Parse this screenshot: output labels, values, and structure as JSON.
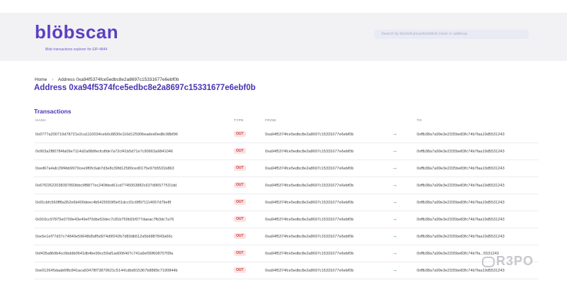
{
  "header": {
    "logo": "blöbscan",
    "tagline": "Blob transactions explorer for EIP-4844",
    "search_placeholder": "Search by block/transaction/blob Hash or address"
  },
  "breadcrumb": {
    "home": "Home",
    "separator": "›",
    "current": "Address 0xa94f5374fce5edbc8e2a8697c15331677e6ebf0b"
  },
  "page_title": "Address 0xa94f5374fce5edbc8e2a8697c15331677e6ebf0b",
  "transactions": {
    "title": "Transactions",
    "columns": [
      "HASH",
      "TYPE",
      "FROM",
      "TO"
    ],
    "rows": [
      {
        "hash": "0x0777a200710d78721e2ca1110034ceb0c8830e116d125906eaded0ed8c98bf96",
        "type": "OUT",
        "from": "0xa94f5374fce5edbc8e2a8697c15331677e6ebf0b",
        "to": "0xffb38a7a99e3e2335be83fc74b7faa19d5531243"
      },
      {
        "hash": "0x903a2f80784fa09e7114d2a08dfecfcdfde7a72cf41b5d71e7c90663a9841046",
        "type": "OUT",
        "from": "0xa94f5374fce5edbc8e2a8697c15331677e6ebf0b",
        "to": "0xffb38a7a99e3e2335be83fc74b7faa19d5531243"
      },
      {
        "hash": "0xed67a4afc29f4bb9970cee9f0fc6ab7d3e8c39fd12580ced0175e97b5531b863",
        "type": "OUT",
        "from": "0xa94f5374fce5edbc8e2a8697c15331677e6ebf0b",
        "to": "0xffb38a7a99e3e2335be83fc74b7faa19d5531243"
      },
      {
        "hash": "0x67f22622038397893bbc9f8877ec240fded61cd7745053882c637d96577531dd",
        "type": "OUT",
        "from": "0xa94f5374fce5edbc8e2a8697c15331677e6ebf0b",
        "to": "0xffb38a7a99e3e2335be83fc74b7faa19d5531243"
      },
      {
        "hash": "0x91cbfc560ff8a352e6b400deec4b5426559f0e51dcc01c6ff971114657d79e8f",
        "type": "OUT",
        "from": "0xa94f5374fce5edbc8e2a8697c15331677e6ebf0b",
        "to": "0xffb38a7a99e3e2335be83fc74b7faa19d5531243"
      },
      {
        "hash": "0x916cc97875e0709e43e49ef70dbe52dec7c81b759b91f077daeac7fb3dc7a76",
        "type": "OUT",
        "from": "0xa94f5374fce5edbc8e2a8697c15331677e6ebf0b",
        "to": "0xffb38a7a99e3e2335be83fc74b7faa19d5531243"
      },
      {
        "hash": "0xe5e1ef77d37c74840e59648d5df5d974d9f242b7d83db512a5b6887843a66c",
        "type": "OUT",
        "from": "0xa94f5374fce5edbc8e2a8697c15331677e6ebf0b",
        "to": "0xffb38a7a99e3e2335be83fc74b7faa19d5531243"
      },
      {
        "hash": "0xf435a8b9b4cc6bddb0641db4be99cc59af1ad006407c741a9ef36f608707f3fa",
        "type": "OUT",
        "from": "0xa94f5374fce5edbc8e2a8697c15331677e6ebf0b",
        "to": "0xffb38a7a99e3e2335be83fc74b7fa...5531243"
      },
      {
        "hash": "0xe012645daab6f8c841aca93478f73879621c51441dbd915367b8889c7190844b",
        "type": "OUT",
        "from": "0xa94f5374fce5edbc8e2a8697c15331677e6ebf0b",
        "to": "0xffb38a7a99e3e2335be83fc74b7faa19d5531243"
      }
    ],
    "arrow_icon": "arrow-right-icon"
  },
  "watermark": "R3PO",
  "colors": {
    "brand": "#5b3fc4",
    "title": "#4a32b5",
    "out_badge_text": "#d23a3a",
    "out_badge_bg": "#fbe3e3",
    "arrow": "#3a9a63",
    "header_bg": "#f2f2f4"
  }
}
